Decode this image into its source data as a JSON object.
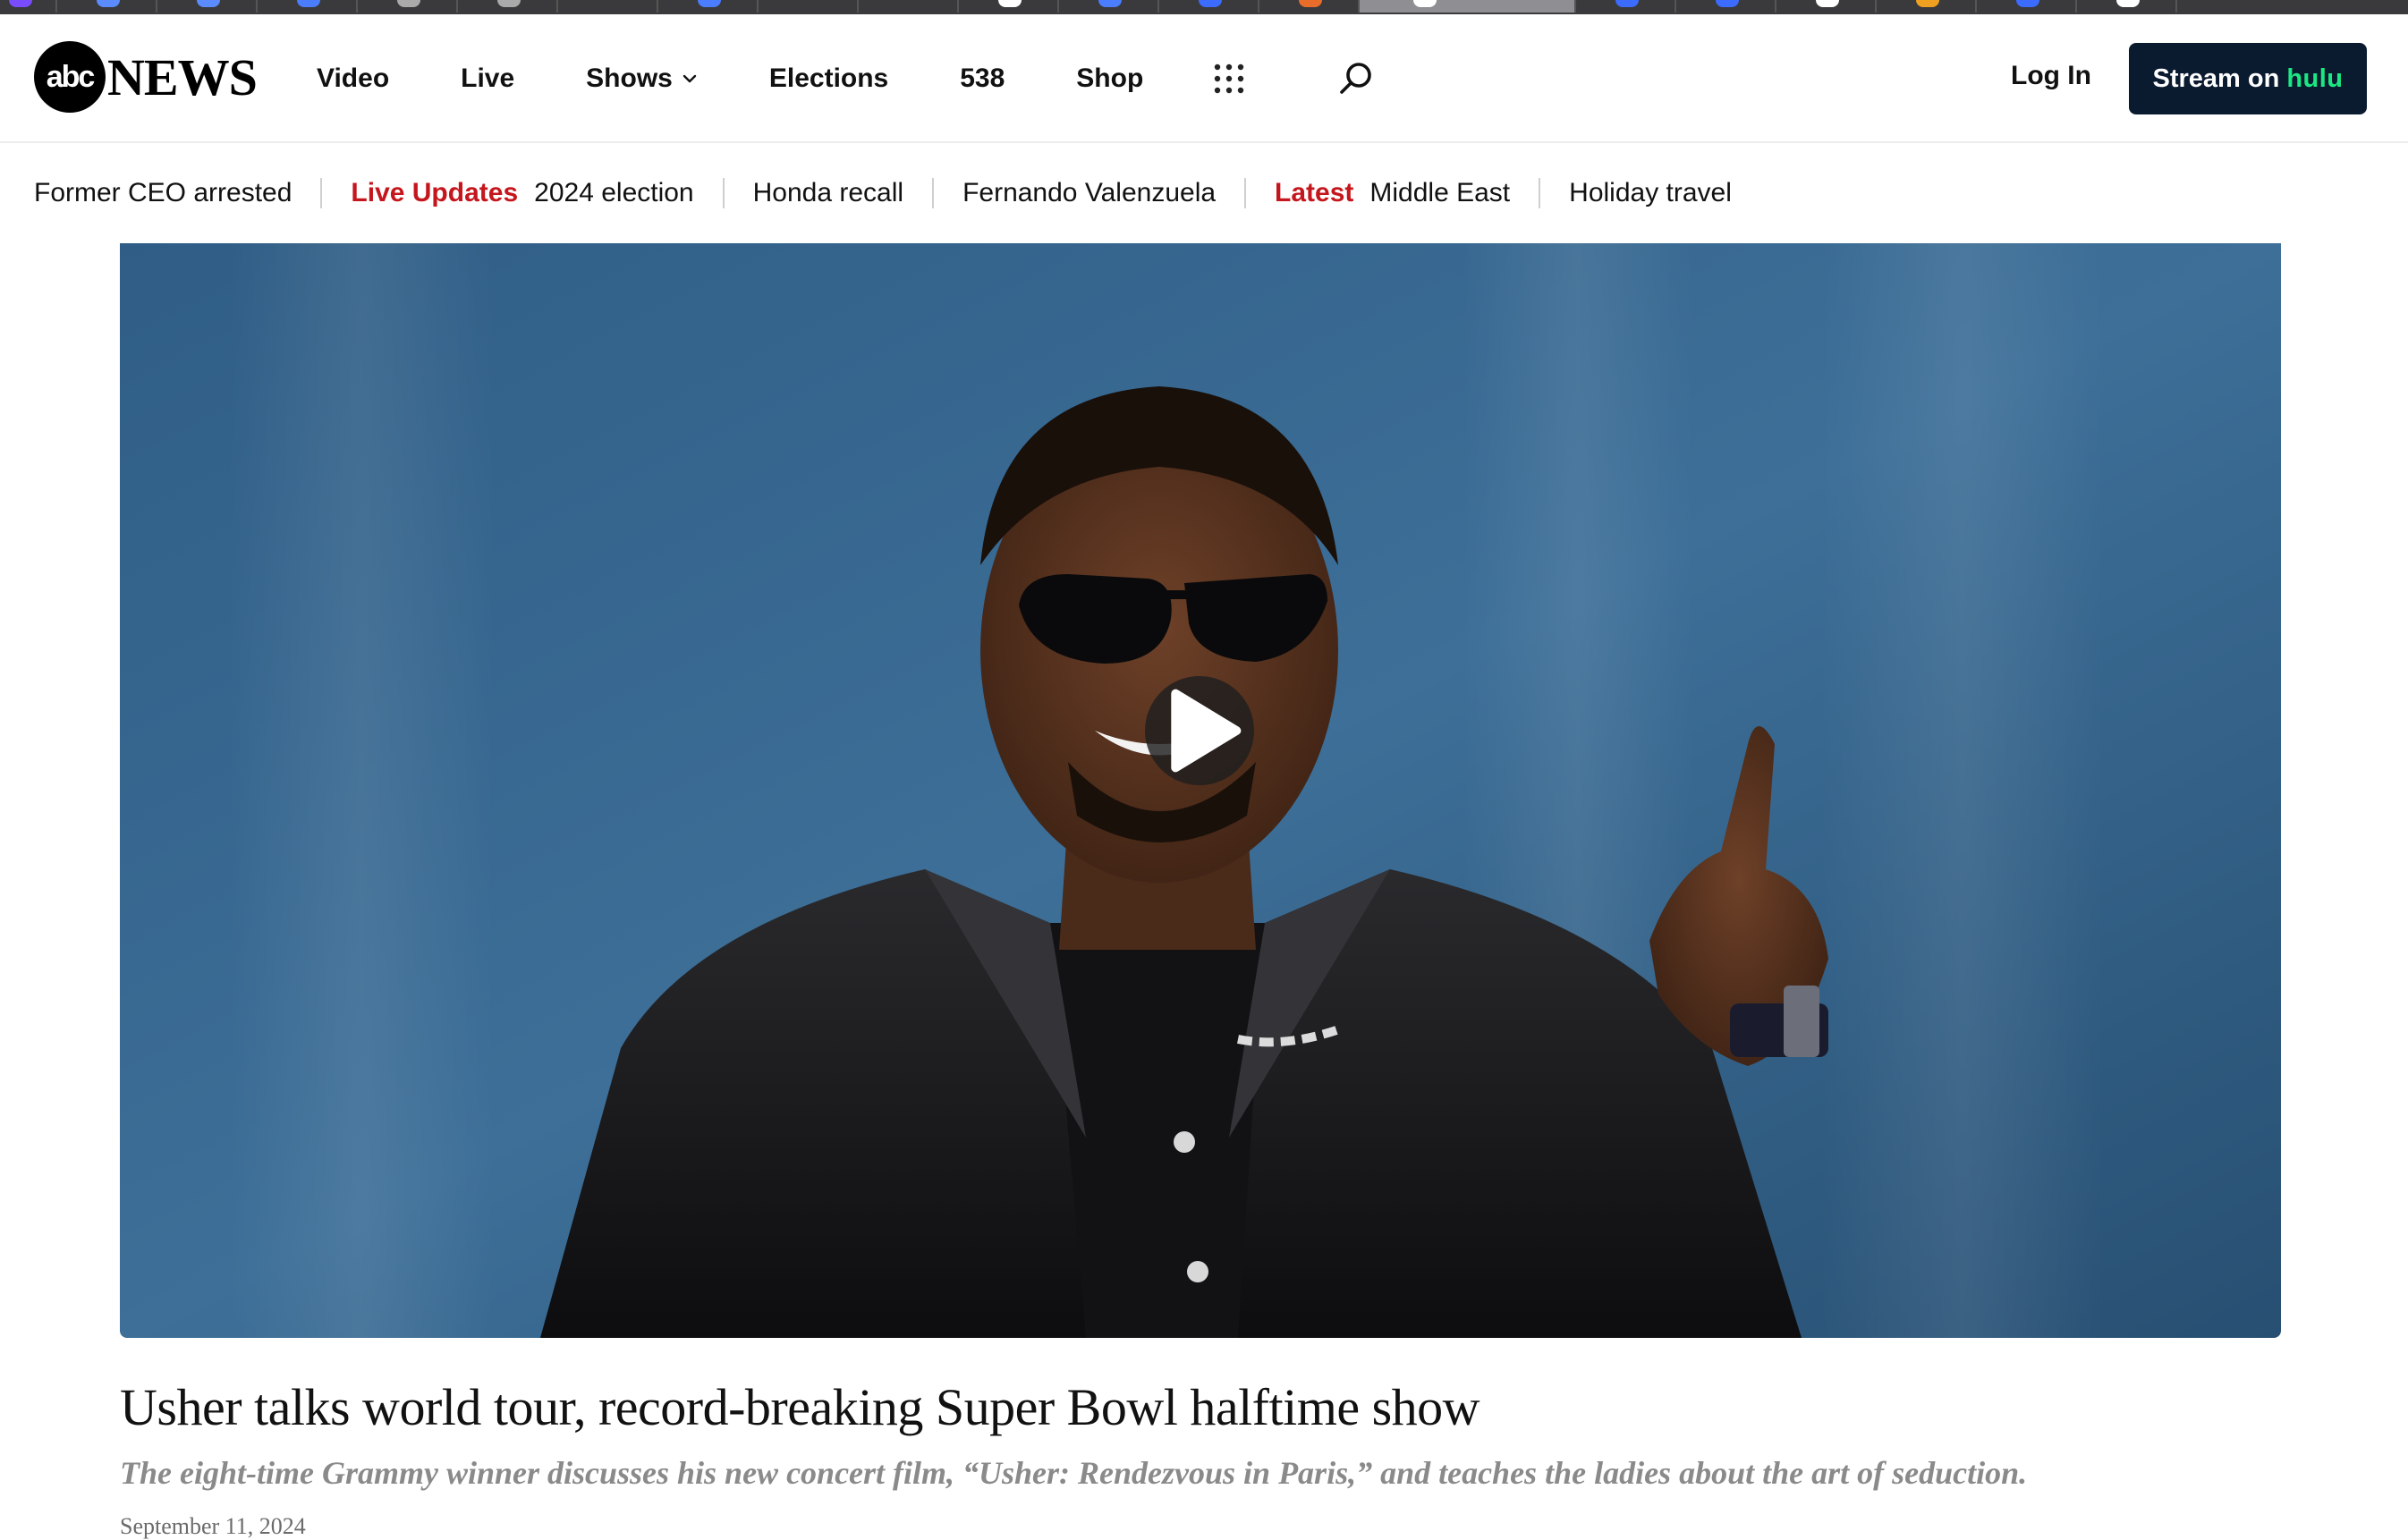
{
  "brand": {
    "logo_circle_text": "abc",
    "logo_word": "NEWS"
  },
  "nav": {
    "items": [
      {
        "label": "Video"
      },
      {
        "label": "Live"
      },
      {
        "label": "Shows"
      },
      {
        "label": "Elections"
      },
      {
        "label": "538"
      },
      {
        "label": "Shop"
      }
    ],
    "login_label": "Log In",
    "stream_label": "Stream on",
    "stream_brand": "hulu"
  },
  "trending": {
    "items": [
      {
        "tag": "",
        "text": "Former CEO arrested"
      },
      {
        "tag": "Live Updates",
        "text": "2024 election"
      },
      {
        "tag": "",
        "text": "Honda recall"
      },
      {
        "tag": "",
        "text": "Fernando Valenzuela"
      },
      {
        "tag": "Latest",
        "text": "Middle East"
      },
      {
        "tag": "",
        "text": "Holiday travel"
      }
    ]
  },
  "article": {
    "headline": "Usher talks world tour, record-breaking Super Bowl halftime show",
    "dek": "The eight-time Grammy winner discusses his new concert film, “Usher: Rendezvous in Paris,” and teaches the ladies about the art of seduction.",
    "date": "September 11, 2024"
  },
  "icons": {
    "shows_dropdown": "chevron-down-icon",
    "apps": "grid-icon",
    "search": "search-icon",
    "play": "play-icon"
  },
  "colors": {
    "accent_red": "#c5161d",
    "hulu_green": "#1ce783",
    "hulu_button_bg": "#0a1a2f"
  }
}
